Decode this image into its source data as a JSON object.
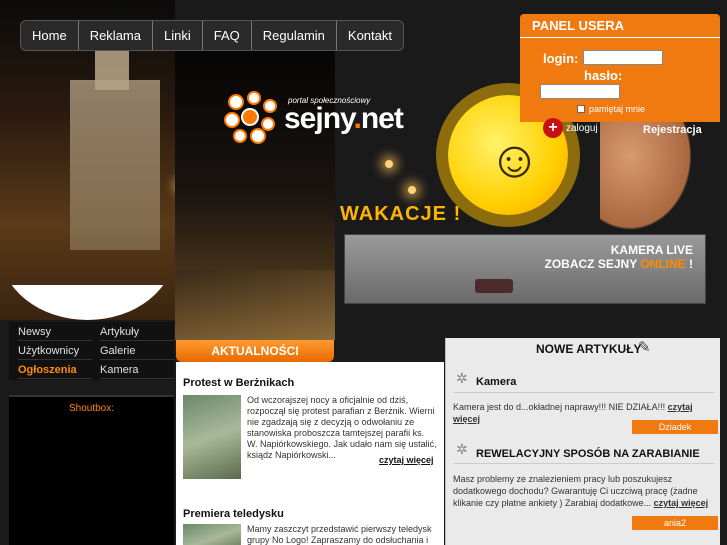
{
  "nav": {
    "items": [
      "Home",
      "Reklama",
      "Linki",
      "FAQ",
      "Regulamin",
      "Kontakt"
    ]
  },
  "logo": {
    "tagline": "portal społecznościowy",
    "name_main": "sejny",
    "name_dot": ".",
    "name_tld": "net"
  },
  "banner": {
    "wakacje": "WAKACJE !",
    "camera_line1": "KAMERA LIVE",
    "camera_line2_prefix": "ZOBACZ SEJNY ",
    "camera_line2_highlight": "ONLINE",
    "camera_line2_suffix": " !"
  },
  "user_panel": {
    "title": "PANEL USERA",
    "login_label": "login:",
    "password_label": "hasło:",
    "remember_label": "pamiętaj mnie",
    "login_button": "zaloguj",
    "register": "Rejestracja"
  },
  "left_menu": {
    "items": [
      "Newsy",
      "Artykuły",
      "Użytkownicy",
      "Galerie",
      "Ogłoszenia",
      "Kamera"
    ]
  },
  "shoutbox": {
    "title": "Shoutbox:"
  },
  "news": {
    "header": "AKTUALNOŚCI",
    "items": [
      {
        "title": "Protest w Berżnikach",
        "text": "Od wczorajszej nocy a oficjalnie od dziś, rozpoczął się protest parafian z Berżnik. Wierni nie zgadzają się z decyzją o odwołaniu ze stanowiska proboszcza tamtejszej parafii ks. W. Napiórkowskiego.  Jak udało nam się ustalić, ksiądz Napiórkowski...",
        "more": "czytaj więcej"
      },
      {
        "title": "Premiera teledysku",
        "text": "Mamy zaszczyt przedstawić pierwszy teledysk grupy No Logo! Zapraszamy do odsłuchania i"
      }
    ]
  },
  "articles": {
    "header": "NOWE ARTYKUŁY",
    "items": [
      {
        "title": "Kamera",
        "text": "Kamera jest do d...okładnej naprawy!!! NIE DZIAŁA!!!",
        "more": "czytaj więcej",
        "author": "Dziadek"
      },
      {
        "title": "REWELACYJNY SPOSÓB NA ZARABIANIE",
        "text": "Masz problemy ze znalezieniem pracy lub poszukujesz dodatkowego dochodu? Gwarantuję Ci uczciwą pracę (żadne klikanie czy płatne ankiety ) Zarabiaj dodatkowe...",
        "more": "czytaj więcej",
        "author": "ania2"
      }
    ]
  }
}
